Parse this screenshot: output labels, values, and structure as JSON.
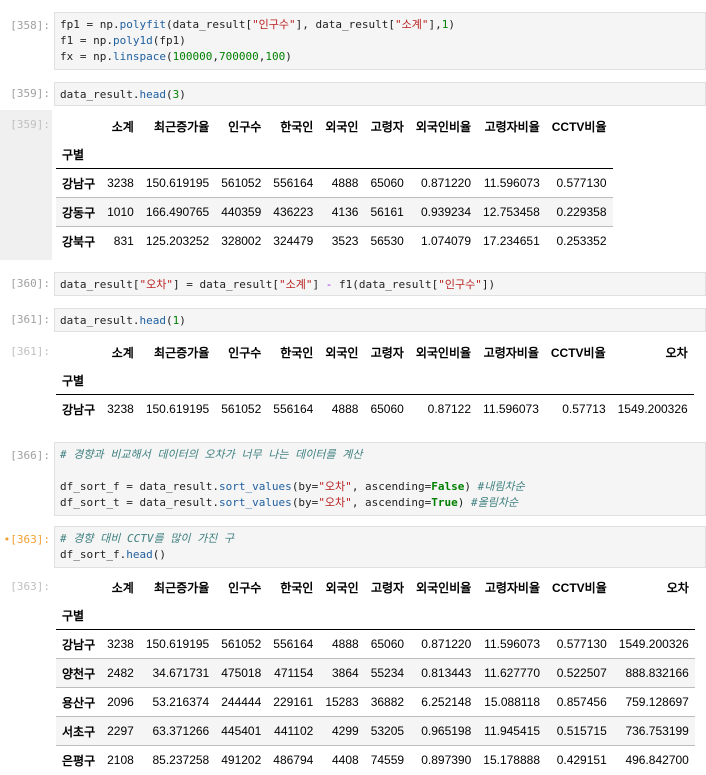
{
  "cells": [
    {
      "prompt": "[358]:",
      "lines": [
        "fp1 = np.polyfit(data_result[\"인구수\"], data_result[\"소계\"],1)",
        "f1 = np.poly1d(fp1)",
        "fx = np.linspace(100000,700000,100)"
      ]
    },
    {
      "prompt": "[359]:",
      "lines": [
        "data_result.head(3)"
      ]
    },
    {
      "prompt": "[360]:",
      "lines": [
        "data_result[\"오차\"] = data_result[\"소계\"] - f1(data_result[\"인구수\"])"
      ]
    },
    {
      "prompt": "[361]:",
      "lines": [
        "data_result.head(1)"
      ]
    },
    {
      "prompt": "[366]:",
      "lines": [
        "# 경향과 비교해서 데이터의 오차가 너무 나는 데이터를 계산",
        "",
        "df_sort_f = data_result.sort_values(by=\"오차\", ascending=False) #내림차순",
        "df_sort_t = data_result.sort_values(by=\"오차\", ascending=True) #올림차순"
      ]
    },
    {
      "prompt": "•[363]:",
      "lines": [
        "# 경향 대비 CCTV를 많이 가진 구",
        "df_sort_f.head()"
      ]
    }
  ],
  "outputs": [
    {
      "prompt": "[359]:",
      "columns": [
        "소계",
        "최근증가율",
        "인구수",
        "한국인",
        "외국인",
        "고령자",
        "외국인비율",
        "고령자비율",
        "CCTV비율"
      ],
      "index_name": "구별",
      "rows": [
        {
          "idx": "강남구",
          "vals": [
            "3238",
            "150.619195",
            "561052",
            "556164",
            "4888",
            "65060",
            "0.871220",
            "11.596073",
            "0.577130"
          ]
        },
        {
          "idx": "강동구",
          "vals": [
            "1010",
            "166.490765",
            "440359",
            "436223",
            "4136",
            "56161",
            "0.939234",
            "12.753458",
            "0.229358"
          ]
        },
        {
          "idx": "강북구",
          "vals": [
            "831",
            "125.203252",
            "328002",
            "324479",
            "3523",
            "56530",
            "1.074079",
            "17.234651",
            "0.253352"
          ]
        }
      ]
    },
    {
      "prompt": "[361]:",
      "columns": [
        "소계",
        "최근증가율",
        "인구수",
        "한국인",
        "외국인",
        "고령자",
        "외국인비율",
        "고령자비율",
        "CCTV비율",
        "오차"
      ],
      "index_name": "구별",
      "rows": [
        {
          "idx": "강남구",
          "vals": [
            "3238",
            "150.619195",
            "561052",
            "556164",
            "4888",
            "65060",
            "0.87122",
            "11.596073",
            "0.57713",
            "1549.200326"
          ]
        }
      ]
    },
    {
      "prompt": "[363]:",
      "columns": [
        "소계",
        "최근증가율",
        "인구수",
        "한국인",
        "외국인",
        "고령자",
        "외국인비율",
        "고령자비율",
        "CCTV비율",
        "오차"
      ],
      "index_name": "구별",
      "rows": [
        {
          "idx": "강남구",
          "vals": [
            "3238",
            "150.619195",
            "561052",
            "556164",
            "4888",
            "65060",
            "0.871220",
            "11.596073",
            "0.577130",
            "1549.200326"
          ]
        },
        {
          "idx": "양천구",
          "vals": [
            "2482",
            "34.671731",
            "475018",
            "471154",
            "3864",
            "55234",
            "0.813443",
            "11.627770",
            "0.522507",
            "888.832166"
          ]
        },
        {
          "idx": "용산구",
          "vals": [
            "2096",
            "53.216374",
            "244444",
            "229161",
            "15283",
            "36882",
            "6.252148",
            "15.088118",
            "0.857456",
            "759.128697"
          ]
        },
        {
          "idx": "서초구",
          "vals": [
            "2297",
            "63.371266",
            "445401",
            "441102",
            "4299",
            "53205",
            "0.965198",
            "11.945415",
            "0.515715",
            "736.753199"
          ]
        },
        {
          "idx": "은평구",
          "vals": [
            "2108",
            "85.237258",
            "491202",
            "486794",
            "4408",
            "74559",
            "0.897390",
            "15.178888",
            "0.429151",
            "496.842700"
          ]
        }
      ]
    }
  ]
}
